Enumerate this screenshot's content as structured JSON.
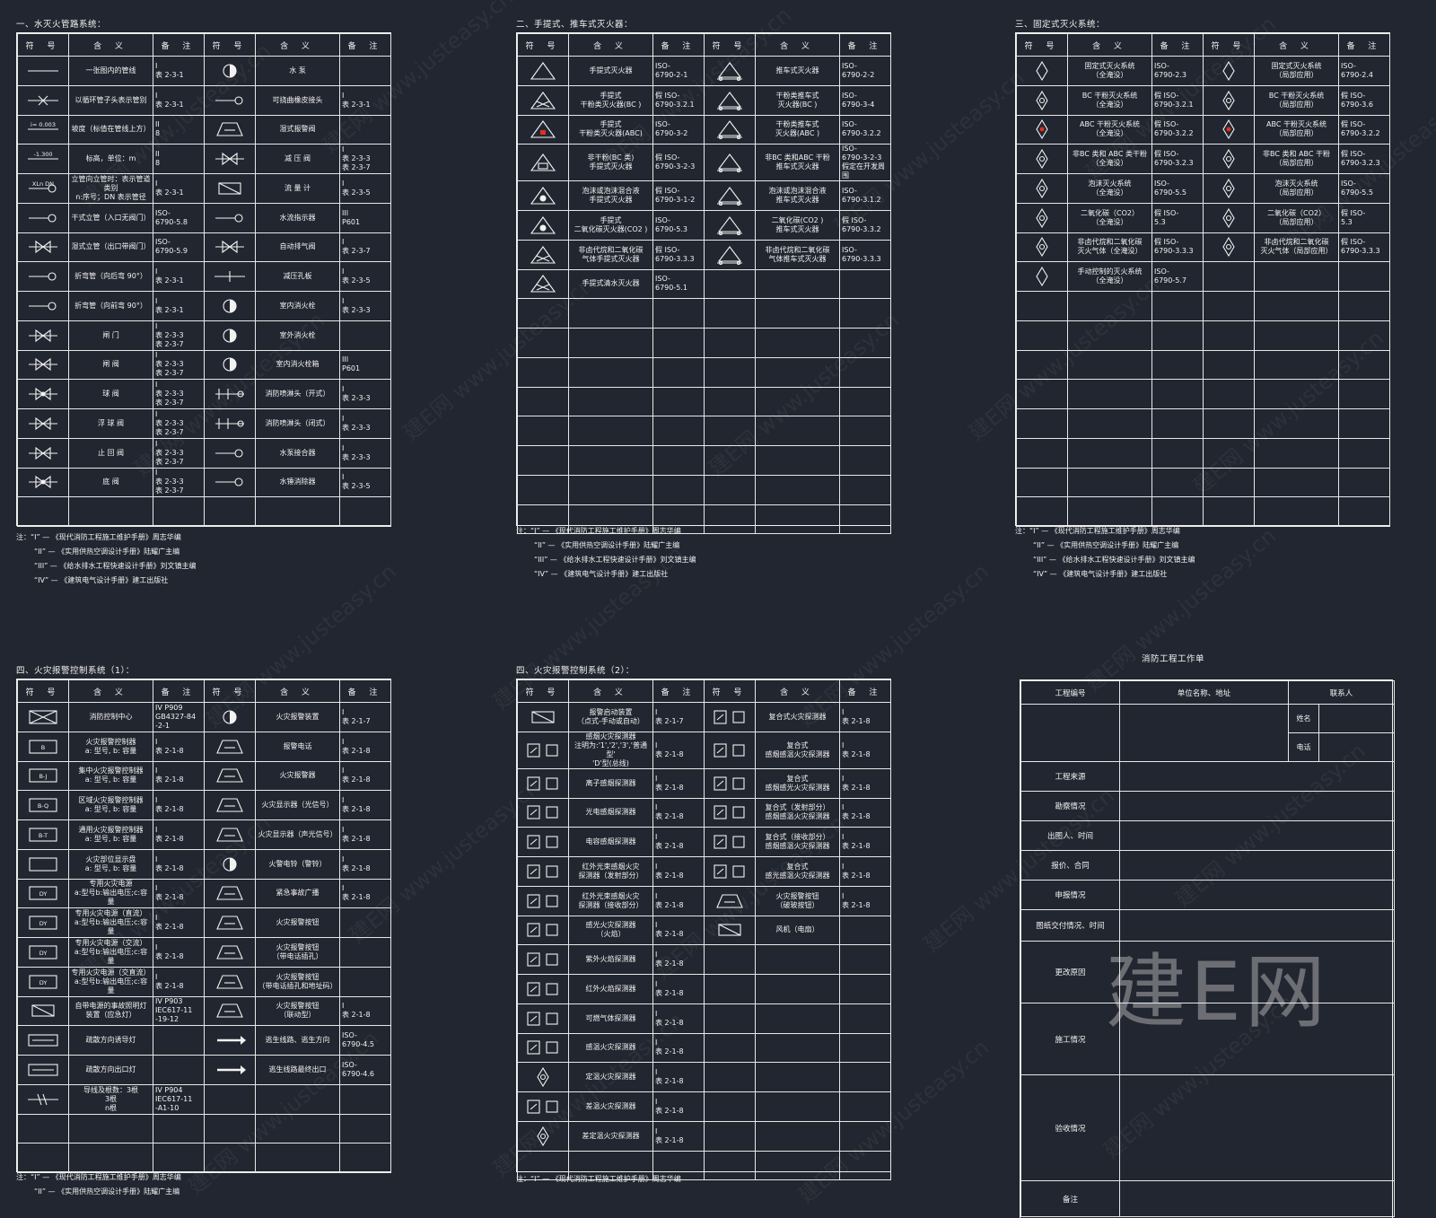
{
  "sections": [
    {
      "id": "s1",
      "title": "一、水灭火管路系统：",
      "headers": [
        "符 号",
        "含 义",
        "备 注",
        "符 号",
        "含 义",
        "备 注"
      ],
      "rows": [
        [
          {
            "icon": "line-icon"
          },
          "一张图内的管线",
          "I\n表 2-3-1",
          {
            "icon": "pump-icon"
          },
          "水 泵",
          ""
        ],
        [
          {
            "icon": "cross-pipe-icon"
          },
          "以循环管子头表示管别",
          "I\n表 2-3-1",
          {
            "icon": "flex-joint-icon"
          },
          "可挠曲橡皮接头",
          "I\n表 2-3-1"
        ],
        [
          {
            "icon": "slope-icon",
            "text": "i= 0.003"
          },
          "坡度（标值在管线上方）",
          "II\n8",
          {
            "icon": "alarm-valve-icon"
          },
          "湿式报警阀",
          ""
        ],
        [
          {
            "icon": "elevation-icon",
            "text": "-1.300"
          },
          "标高，单位：m",
          "II\n8",
          {
            "icon": "reducer-valve-icon"
          },
          "减 压 阀",
          "I\n表 2-3-3\n表 2-3-7"
        ],
        [
          {
            "icon": "riser-icon",
            "text": "XLn DN"
          },
          "立管向立管时：表示管道类别\nn:序号；DN 表示管径",
          "I\n表 2-3-1",
          {
            "icon": "meter-icon"
          },
          "流 量 计",
          "I\n表 2-3-5"
        ],
        [
          {
            "icon": "inlet-icon"
          },
          "干式立管（入口无阀门）",
          "ISO-\n6790-5.8",
          {
            "icon": "flow-indicator-icon"
          },
          "水流指示器",
          "III\nP601"
        ],
        [
          {
            "icon": "inlet-valve-icon"
          },
          "湿式立管（出口带阀门）",
          "ISO-\n6790-5.9",
          {
            "icon": "exhaust-valve-icon"
          },
          "自动排气阀",
          "I\n表 2-3-7"
        ],
        [
          {
            "icon": "bend-up-icon"
          },
          "折弯管（向后弯 90°）",
          "I\n表 2-3-1",
          {
            "icon": "orifice-icon"
          },
          "减压孔板",
          "I\n表 2-3-5"
        ],
        [
          {
            "icon": "bend-down-icon"
          },
          "折弯管（向前弯 90°）",
          "I\n表 2-3-1",
          {
            "icon": "indoor-hydrant-icon"
          },
          "室内消火栓",
          "I\n表 2-3-3"
        ],
        [
          {
            "icon": "gate-valve-icon"
          },
          "闸 门",
          "I\n表 2-3-3\n表 2-3-7",
          {
            "icon": "outdoor-hydrant-icon"
          },
          "室外消火栓",
          ""
        ],
        [
          {
            "icon": "stop-valve-icon"
          },
          "闸 阀",
          "I\n表 2-3-3\n表 2-3-7",
          {
            "icon": "hydrant-box-icon"
          },
          "室内消火栓箱",
          "III\nP601"
        ],
        [
          {
            "icon": "ball-valve-icon"
          },
          "球 阀",
          "I\n表 2-3-3\n表 2-3-7",
          {
            "icon": "sprinkler-open-icon"
          },
          "消防喷淋头（开式）",
          "I\n表 2-3-3"
        ],
        [
          {
            "icon": "float-valve-icon"
          },
          "浮 球 阀",
          "I\n表 2-3-3\n表 2-3-7",
          {
            "icon": "sprinkler-closed-icon"
          },
          "消防喷淋头（闭式）",
          "I\n表 2-3-3"
        ],
        [
          {
            "icon": "check-valve-icon"
          },
          "止 回 阀",
          "I\n表 2-3-3\n表 2-3-7",
          {
            "icon": "pump-adapter-icon"
          },
          "水泵接合器",
          "I\n表 2-3-3"
        ],
        [
          {
            "icon": "foot-valve-icon"
          },
          "底 阀",
          "I\n表 2-3-3\n表 2-3-7",
          {
            "icon": "hammer-arrester-icon"
          },
          "水锤消除器",
          "I\n表 2-3-5"
        ],
        [
          "",
          "",
          "",
          "",
          "",
          ""
        ]
      ],
      "notes": [
        "注：“I” — 《现代消防工程施工维护手册》周志华编",
        "“II” — 《实用供热空调设计手册》陆耀广主编",
        "“III” — 《给水排水工程快速设计手册》刘文镇主编",
        "“IV” — 《建筑电气设计手册》建工出版社"
      ]
    },
    {
      "id": "s2",
      "title": "二、手提式、推车式灭火器：",
      "headers": [
        "符 号",
        "含 义",
        "备 注",
        "符 号",
        "含 义",
        "备 注"
      ],
      "rows": [
        [
          {
            "icon": "extinguisher-icon"
          },
          "手提式灭火器",
          "ISO-\n6790-2-1",
          {
            "icon": "cart-extinguisher-icon"
          },
          "推车式灭火器",
          "ISO-\n6790-2-2"
        ],
        [
          {
            "icon": "bc-extinguisher-icon"
          },
          "手提式\n干粉类灭火器(BC )",
          "假 ISO-\n6790-3.2.1",
          {
            "icon": "bc-cart-icon"
          },
          "干粉类推车式\n灭火器(BC )",
          "ISO-\n6790-3-4"
        ],
        [
          {
            "icon": "abc-extinguisher-icon"
          },
          "手提式\n干粉类灭火器(ABC)",
          "ISO-\n6790-3-2",
          {
            "icon": "abc-cart-icon"
          },
          "干粉类推车式\n灭火器(ABC )",
          "ISO-\n6790-3.2.2"
        ],
        [
          {
            "icon": "non-bc-extinguisher-icon"
          },
          "非干粉(BC 类)\n手提式灭火器",
          "假 ISO-\n6790-3-2-3",
          {
            "icon": "non-bc-cart-icon"
          },
          "非BC 类和ABC 干粉\n推车式灭火器",
          "ISO-\n6790-3-2-3\n假定在开发周围"
        ],
        [
          {
            "icon": "foam-extinguisher-icon"
          },
          "泡沫或泡沫混合液\n手提式灭火器",
          "假 ISO-\n6790-3-1-2",
          {
            "icon": "foam-cart-icon"
          },
          "泡沫或泡沫混合液\n推车式灭火器",
          "ISO-\n6790-3.1.2"
        ],
        [
          {
            "icon": "co2-extinguisher-icon"
          },
          "手提式\n二氧化碳灭火器(CO2 )",
          "ISO-\n6790-5.3",
          {
            "icon": "co2-cart-icon"
          },
          "二氧化碳(CO2 )\n推车式灭火器",
          "假 ISO-\n6790-3.3.2"
        ],
        [
          {
            "icon": "halon-extinguisher-icon"
          },
          "非卤代烷和二氧化碳\n气体手提式灭火器",
          "假 ISO-\n6790-3.3.3",
          {
            "icon": "halon-cart-icon"
          },
          "非卤代烷和二氧化碳\n气体推车式灭火器",
          "ISO-\n6790-3.3.3"
        ],
        [
          {
            "icon": "water-extinguisher-icon"
          },
          "手提式清水灭火器",
          "ISO-\n6790-5.1",
          "",
          "",
          ""
        ],
        [
          "",
          "",
          "",
          "",
          "",
          ""
        ],
        [
          "",
          "",
          "",
          "",
          "",
          ""
        ],
        [
          "",
          "",
          "",
          "",
          "",
          ""
        ],
        [
          "",
          "",
          "",
          "",
          "",
          ""
        ],
        [
          "",
          "",
          "",
          "",
          "",
          ""
        ],
        [
          "",
          "",
          "",
          "",
          "",
          ""
        ],
        [
          "",
          "",
          "",
          "",
          "",
          ""
        ],
        [
          "",
          "",
          "",
          "",
          "",
          ""
        ]
      ],
      "notes": [
        "注：“I” — 《现代消防工程施工维护手册》周志华编",
        "“II” — 《实用供热空调设计手册》陆耀广主编",
        "“III” — 《给水排水工程快速设计手册》刘文镇主编",
        "“IV” — 《建筑电气设计手册》建工出版社"
      ]
    },
    {
      "id": "s3",
      "title": "三、固定式灭火系统：",
      "headers": [
        "符 号",
        "含 义",
        "备 注",
        "符 号",
        "含 义",
        "备 注"
      ],
      "rows": [
        [
          {
            "icon": "fixed-system-icon"
          },
          "固定式灭火系统\n（全淹没）",
          "ISO-\n6790-2.3",
          {
            "icon": "fixed-system-local-icon"
          },
          "固定式灭火系统\n（局部应用）",
          "ISO-\n6790-2.4"
        ],
        [
          {
            "icon": "bc-fixed-icon"
          },
          "BC 干粉灭火系统\n（全淹没）",
          "假 ISO-\n6790-3.2.1",
          {
            "icon": "bc-fixed-local-icon"
          },
          "BC 干粉灭火系统\n（局部应用）",
          "假 ISO-\n6790-3.6"
        ],
        [
          {
            "icon": "abc-fixed-icon"
          },
          "ABC 干粉灭火系统\n（全淹没）",
          "假 ISO-\n6790-3.2.2",
          {
            "icon": "abc-fixed-local-icon"
          },
          "ABC 干粉灭火系统\n（局部应用）",
          "假 ISO-\n6790-3.2.2"
        ],
        [
          {
            "icon": "non-bc-fixed-icon"
          },
          "非BC 类和 ABC 类干粉\n（全淹没）",
          "假 ISO-\n6790-3.2.3",
          {
            "icon": "non-bc-fixed-local-icon"
          },
          "非BC 类和 ABC 干粉\n（局部应用）",
          "假 ISO-\n6790-3.2.3"
        ],
        [
          {
            "icon": "foam-fixed-icon"
          },
          "泡沫灭火系统\n（全淹没）",
          "ISO-\n6790-5.5",
          {
            "icon": "foam-fixed-local-icon"
          },
          "泡沫灭火系统\n（局部应用）",
          "ISO-\n6790-5.5"
        ],
        [
          {
            "icon": "co2-fixed-icon"
          },
          "二氧化碳（CO2）\n（全淹没）",
          "假 ISO-\n5.3",
          {
            "icon": "co2-fixed-local-icon"
          },
          "二氧化碳（CO2）\n（局部应用）",
          "假 ISO-\n5.3"
        ],
        [
          {
            "icon": "halon-fixed-icon"
          },
          "非卤代烷和二氧化碳\n灭火气体（全淹没）",
          "假 ISO-\n6790-3.3.3",
          {
            "icon": "halon-fixed-local-icon"
          },
          "非卤代烷和二氧化碳\n灭火气体（局部应用）",
          "假 ISO-\n6790-3.3.3"
        ],
        [
          {
            "icon": "manual-fixed-icon"
          },
          "手动控制的灭火系统\n（全淹没）",
          "ISO-\n6790-5.7",
          "",
          "",
          ""
        ],
        [
          "",
          "",
          "",
          "",
          "",
          ""
        ],
        [
          "",
          "",
          "",
          "",
          "",
          ""
        ],
        [
          "",
          "",
          "",
          "",
          "",
          ""
        ],
        [
          "",
          "",
          "",
          "",
          "",
          ""
        ],
        [
          "",
          "",
          "",
          "",
          "",
          ""
        ],
        [
          "",
          "",
          "",
          "",
          "",
          ""
        ],
        [
          "",
          "",
          "",
          "",
          "",
          ""
        ],
        [
          "",
          "",
          "",
          "",
          "",
          ""
        ]
      ],
      "notes": [
        "注：“I” — 《现代消防工程施工维护手册》周志华编",
        "“II” — 《实用供热空调设计手册》陆耀广主编",
        "“III” — 《给水排水工程快速设计手册》刘文镇主编",
        "“IV” — 《建筑电气设计手册》建工出版社"
      ]
    },
    {
      "id": "s4",
      "title": "四、火灾报警控制系统（1）：",
      "headers": [
        "符 号",
        "含 义",
        "备 注",
        "符 号",
        "含 义",
        "备 注"
      ],
      "rows": [
        [
          {
            "icon": "control-center-icon"
          },
          "消防控制中心",
          "IV P909\nGB4327-84\n-2-1",
          {
            "icon": "fire-alarm-bell-icon"
          },
          "火灾报警装置",
          "I\n表 2-1-7"
        ],
        [
          {
            "icon": "alarm-controller-icon",
            "text": "B"
          },
          "火灾报警控制器\na: 型号, b: 容量",
          "I\n表 2-1-8",
          {
            "icon": "alarm-phone-icon"
          },
          "报警电话",
          "I\n表 2-1-8"
        ],
        [
          {
            "icon": "central-controller-icon",
            "text": "B-J"
          },
          "集中火灾报警控制器\na: 型号, b: 容量",
          "I\n表 2-1-8",
          {
            "icon": "fire-alarm-icon"
          },
          "火灾报警器",
          "I\n表 2-1-8"
        ],
        [
          {
            "icon": "zone-controller-icon",
            "text": "B-Q"
          },
          "区域火灾报警控制器\na: 型号, b: 容量",
          "I\n表 2-1-8",
          {
            "icon": "fire-display-light-icon"
          },
          "火灾显示器（光信号）",
          "I\n表 2-1-8"
        ],
        [
          {
            "icon": "general-controller-icon",
            "text": "B-T"
          },
          "通用火灾报警控制器\na: 型号, b: 容量",
          "I\n表 2-1-8",
          {
            "icon": "fire-display-sound-icon"
          },
          "火灾显示器（声光信号）",
          "I\n表 2-1-8"
        ],
        [
          {
            "icon": "fire-location-icon"
          },
          "火灾部位显示盘\na: 型号, b: 容量",
          "I\n表 2-1-8",
          {
            "icon": "fire-bell-icon"
          },
          "火警电铃（警铃）",
          "I\n表 2-1-8"
        ],
        [
          {
            "icon": "dy-power-icon",
            "text": "DY"
          },
          "专用火灾电源\na:型号b:输出电压;c:容量",
          "I\n表 2-1-8",
          {
            "icon": "emergency-broadcast-icon"
          },
          "紧急事故广播",
          "I\n表 2-1-8"
        ],
        [
          {
            "icon": "dy-dc-power-icon",
            "text": "DY"
          },
          "专用火灾电源（直流）\na:型号b:输出电压;c:容量",
          "I\n表 2-1-8",
          {
            "icon": "alarm-button-icon"
          },
          "火灾报警按钮",
          ""
        ],
        [
          {
            "icon": "dy-ac-power-icon",
            "text": "DY"
          },
          "专用火灾电源（交流）\na:型号b:输出电压;c:容量",
          "I\n表 2-1-8",
          {
            "icon": "alarm-button-phone-icon"
          },
          "火灾报警按钮\n（带电话插孔）",
          ""
        ],
        [
          {
            "icon": "dy-acdc-power-icon",
            "text": "DY"
          },
          "专用火灾电源（交直流）\na:型号b:输出电压;c:容量",
          "I\n表 2-1-8",
          {
            "icon": "alarm-button-broadcast-icon"
          },
          "火灾报警按钮\n（带电话插孔和地址码）",
          ""
        ],
        [
          {
            "icon": "emergency-light-icon"
          },
          "自带电源的事故照明灯\n装置（应急灯）",
          "IV P903\nIEC617-11\n-19-12",
          {
            "icon": "alarm-button-linkage-icon"
          },
          "火灾报警按钮\n（联动型）",
          "I\n表 2-1-8"
        ],
        [
          {
            "icon": "evacuation-sign-icon"
          },
          "疏散方向诱导灯",
          "",
          {
            "icon": "escape-route-icon"
          },
          "逃生线路、逃生方向",
          "ISO-\n6790-4.5"
        ],
        [
          {
            "icon": "exit-light-icon"
          },
          "疏散方向出口灯",
          "",
          {
            "icon": "escape-exit-icon"
          },
          "逃生线路最终出口",
          "ISO-\n6790-4.6"
        ],
        [
          {
            "icon": "wire-count-icon"
          },
          "导线及根数：3根\n3根\nn根",
          "IV P904\nIEC617-11\n-A1-10",
          "",
          "",
          ""
        ],
        [
          "",
          "",
          "",
          "",
          "",
          ""
        ],
        [
          "",
          "",
          "",
          "",
          "",
          ""
        ]
      ],
      "notes": [
        "注：“I” — 《现代消防工程施工维护手册》周志华编",
        "“II” — 《实用供热空调设计手册》陆耀广主编"
      ]
    },
    {
      "id": "s5",
      "title": "四、火灾报警控制系统（2）：",
      "headers": [
        "符 号",
        "含 义",
        "备 注",
        "符 号",
        "含 义",
        "备 注"
      ],
      "rows": [
        [
          {
            "icon": "alarm-start-icon"
          },
          "报警启动装置\n（点式-手动或自动）",
          "I\n表 2-1-7",
          {
            "icon": "composite-detector-icon"
          },
          "复合式火灾探测器",
          "I\n表 2-1-8"
        ],
        [
          {
            "icon": "smoke-detector-icon"
          },
          "感烟火灾探测器\n注明为:'1','2','3','普通型'\n'D'型(总线)",
          "I\n表 2-1-8",
          {
            "icon": "composite-smoke-temp-icon"
          },
          "复合式\n感烟感温火灾探测器",
          "I\n表 2-1-8"
        ],
        [
          {
            "icon": "ion-smoke-icon"
          },
          "离子感烟探测器",
          "I\n表 2-1-8",
          {
            "icon": "composite-smoke-light-icon"
          },
          "复合式\n感烟感光火灾探测器",
          "I\n表 2-1-8"
        ],
        [
          {
            "icon": "photo-smoke-icon"
          },
          "光电感烟探测器",
          "I\n表 2-1-8",
          {
            "icon": "composite-beam-tx-icon"
          },
          "复合式（发射部分）\n感烟感温火灾探测器",
          "I\n表 2-1-8"
        ],
        [
          {
            "icon": "capacitive-smoke-icon"
          },
          "电容感烟探测器",
          "I\n表 2-1-8",
          {
            "icon": "composite-beam-rx-icon"
          },
          "复合式（接收部分）\n感烟感温火灾探测器",
          "I\n表 2-1-8"
        ],
        [
          {
            "icon": "ir-beam-tx-icon"
          },
          "红外光束感烟火灾\n探测器（发射部分）",
          "I\n表 2-1-8",
          {
            "icon": "composite-light-temp-icon"
          },
          "复合式\n感光感温火灾探测器",
          "I\n表 2-1-8"
        ],
        [
          {
            "icon": "ir-beam-rx-icon"
          },
          "红外光束感烟火灾\n探测器（接收部分）",
          "I\n表 2-1-8",
          {
            "icon": "alarm-button-break-icon"
          },
          "火灾报警按钮\n（破玻按钮）",
          "I\n表 2-1-8"
        ],
        [
          {
            "icon": "flame-detector-icon"
          },
          "感光火灾探测器\n（火焰）",
          "I\n表 2-1-8",
          {
            "icon": "fan-icon"
          },
          "风机（电扇）",
          ""
        ],
        [
          {
            "icon": "uv-flame-icon"
          },
          "紫外火焰探测器",
          "I\n表 2-1-8",
          "",
          "",
          ""
        ],
        [
          {
            "icon": "ir-flame-icon"
          },
          "红外火焰探测器",
          "I\n表 2-1-8",
          "",
          "",
          ""
        ],
        [
          {
            "icon": "gas-detector-icon"
          },
          "可燃气体探测器",
          "I\n表 2-1-8",
          "",
          "",
          ""
        ],
        [
          {
            "icon": "heat-detector-icon"
          },
          "感温火灾探测器",
          "I\n表 2-1-8",
          "",
          "",
          ""
        ],
        [
          {
            "icon": "fixed-temp-icon"
          },
          "定温火灾探测器",
          "I\n表 2-1-8",
          "",
          "",
          ""
        ],
        [
          {
            "icon": "rate-rise-icon"
          },
          "差温火灾探测器",
          "I\n表 2-1-8",
          "",
          "",
          ""
        ],
        [
          {
            "icon": "rate-fixed-icon"
          },
          "差定温火灾探测器",
          "I\n表 2-1-8",
          "",
          "",
          ""
        ],
        [
          "",
          "",
          "",
          "",
          "",
          ""
        ]
      ],
      "notes": [
        "注：“I” — 《现代消防工程施工维护手册》周志华编"
      ]
    }
  ],
  "work_order": {
    "title": "消防工程工作单",
    "col_headers": [
      "工程编号",
      "单位名称、地址",
      "联系人"
    ],
    "contact_labels": [
      "姓名",
      "电话"
    ],
    "rows": [
      "工程来源",
      "勘察情况",
      "出图人、时间",
      "报价、合同",
      "申报情况",
      "图纸交付情况、时间",
      "更改原因",
      "施工情况",
      "验收情况",
      "备注"
    ]
  },
  "watermark": {
    "text": "建E网 www.justeasy.cn",
    "logo": "建E网"
  }
}
